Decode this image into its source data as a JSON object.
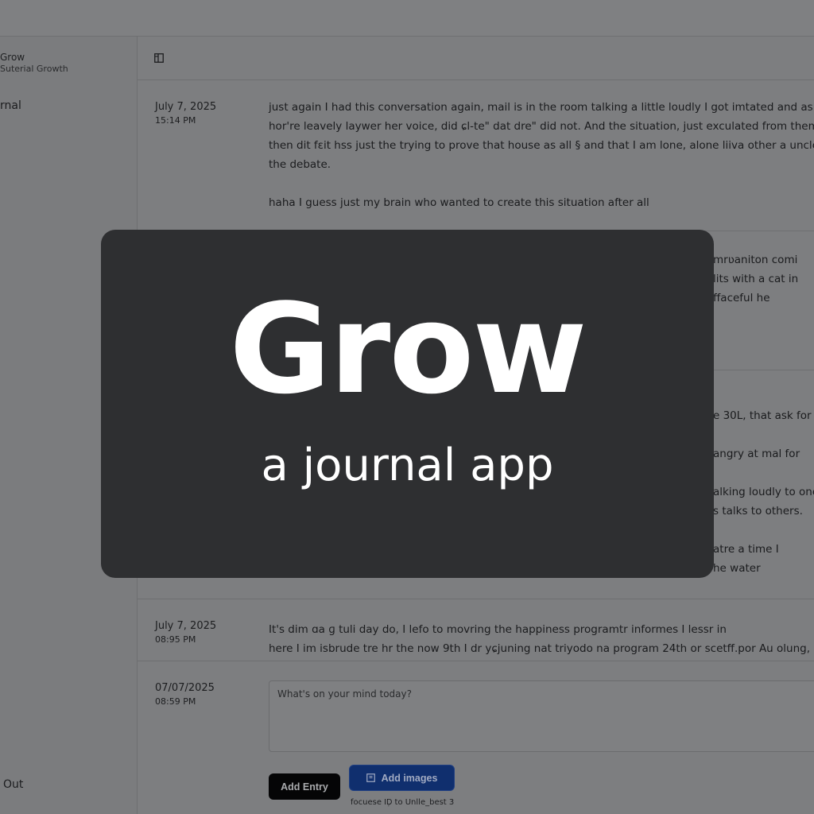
{
  "app": {
    "name": "Grow",
    "tagline": "Suterial Growth"
  },
  "sidebar": {
    "nav_journal": "rnal",
    "sign_out": "Out"
  },
  "entries": [
    {
      "date": "July 7, 2025",
      "time": "15:14 PM",
      "lines": [
        "just again I had this conversation again, mail is in the room talking a little loudly I got imtated and ask",
        "hor're leavely laywer her voice, did ɕl-te\" dat dre\" did not. And the situation, just exculated from them",
        "then dit fɛit hss just the trying to prove that house as all § and that I am lone, alone liiva other a uncle",
        "the debate.",
        "",
        "haha I guess just my brain who wanted to create this situation after all"
      ]
    },
    {
      "lines": [
        "mrʋaniton comi",
        "lits with a cat in",
        "ffaceful he"
      ]
    },
    {
      "lines": [
        "e 30L, that ask for",
        "",
        "angry at mal for",
        "",
        "alking loudly to onc",
        "s talks to others.",
        "",
        "atre a time I",
        "he water"
      ]
    },
    {
      "date": "July 7, 2025",
      "time": "08:95 PM",
      "lines": [
        "It's dim ɑa ɡ tuli day do, I lefo to movring the happiness programtr informes I lessr in",
        "here I im isbrude tre hr the now 9th I dr yɕjuning nat triyodo na program 24th or scetff.por Au olung,"
      ]
    }
  ],
  "composer": {
    "date": "07/07/2025",
    "time": "08:59 PM",
    "placeholder": "What's on your mind today?",
    "add_entry_label": "Add Entry",
    "add_images_label": "Add images",
    "images_hint": "focuese ID᷊ to Unlle_best 3"
  },
  "overlay": {
    "title": "Grow",
    "subtitle": "a journal app"
  },
  "icons": {
    "sidebar_toggle": "sidebar-toggle-icon",
    "image": "image-icon"
  },
  "colors": {
    "overlay_bg": "#2e2f31",
    "primary_button": "#050506",
    "accent_button": "#102f6e"
  }
}
